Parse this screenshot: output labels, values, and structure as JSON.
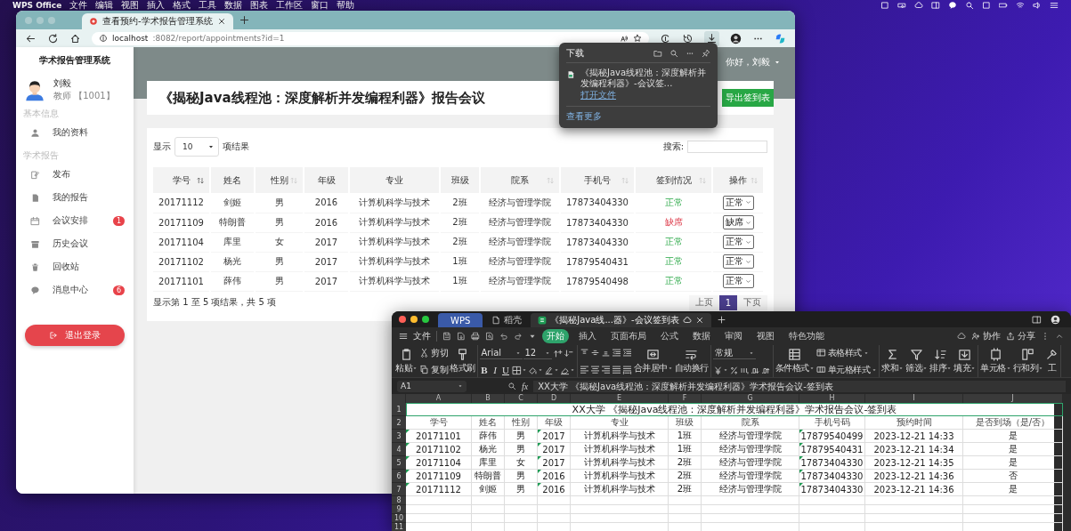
{
  "menubar": {
    "app": "WPS Office",
    "menus": [
      "文件",
      "编辑",
      "视图",
      "插入",
      "格式",
      "工具",
      "数据",
      "图表",
      "工作区",
      "窗口",
      "帮助"
    ]
  },
  "browser": {
    "tabs": [
      {
        "title": "查看预约-学术报告管理系统",
        "selected": true
      }
    ],
    "url": {
      "host": "localhost",
      "path": ":8082/report/appointments?id=1"
    },
    "sidebar": {
      "title": "学术报告管理系统",
      "user": {
        "name": "刘毅",
        "role": "教师 【1001】"
      },
      "sections": [
        {
          "heading": "基本信息",
          "items": [
            {
              "label": "我的资料"
            }
          ]
        },
        {
          "heading": "学术报告",
          "items": [
            {
              "label": "发布"
            },
            {
              "label": "我的报告"
            },
            {
              "label": "会议安排",
              "badge": "1"
            },
            {
              "label": "历史会议"
            },
            {
              "label": "回收站"
            },
            {
              "label": "消息中心",
              "badge": "6"
            }
          ]
        }
      ],
      "logout": "退出登录"
    },
    "greeting": "你好，刘毅",
    "page_title": "《揭秘Java线程池：深度解析并发编程利器》报告会议",
    "export_button": "导出签到表",
    "table_controls": {
      "show_label": "显示",
      "page_size": "10",
      "show_suffix": "项结果",
      "search_label": "搜索:"
    },
    "table": {
      "columns": [
        {
          "label": "学号",
          "sortable": true,
          "sorted": true
        },
        {
          "label": "姓名",
          "sortable": false,
          "sorted": false
        },
        {
          "label": "性别",
          "sortable": true,
          "sorted": false
        },
        {
          "label": "年级",
          "sortable": false,
          "sorted": false
        },
        {
          "label": "专业",
          "sortable": false,
          "sorted": false
        },
        {
          "label": "班级",
          "sortable": false,
          "sorted": false
        },
        {
          "label": "院系",
          "sortable": true,
          "sorted": false
        },
        {
          "label": "手机号",
          "sortable": true,
          "sorted": false
        },
        {
          "label": "签到情况",
          "sortable": true,
          "sorted": false
        },
        {
          "label": "操作",
          "sortable": true,
          "sorted": false
        }
      ],
      "rows": [
        {
          "cells": [
            "20171112",
            "剑姬",
            "男",
            "2016",
            "计算机科学与技术",
            "2班",
            "经济与管理学院",
            "17873404330"
          ],
          "status": {
            "text": "正常",
            "kind": "normal"
          },
          "action": "正常"
        },
        {
          "cells": [
            "20171109",
            "特朗普",
            "男",
            "2016",
            "计算机科学与技术",
            "2班",
            "经济与管理学院",
            "17873404330"
          ],
          "status": {
            "text": "缺席",
            "kind": "absent"
          },
          "action": "缺席"
        },
        {
          "cells": [
            "20171104",
            "库里",
            "女",
            "2017",
            "计算机科学与技术",
            "2班",
            "经济与管理学院",
            "17873404330"
          ],
          "status": {
            "text": "正常",
            "kind": "normal"
          },
          "action": "正常"
        },
        {
          "cells": [
            "20171102",
            "杨光",
            "男",
            "2017",
            "计算机科学与技术",
            "1班",
            "经济与管理学院",
            "17879540431"
          ],
          "status": {
            "text": "正常",
            "kind": "normal"
          },
          "action": "正常"
        },
        {
          "cells": [
            "20171101",
            "薛伟",
            "男",
            "2017",
            "计算机科学与技术",
            "1班",
            "经济与管理学院",
            "17879540498"
          ],
          "status": {
            "text": "正常",
            "kind": "normal"
          },
          "action": "正常"
        }
      ]
    },
    "table_info": "显示第 1 至 5 项结果，共 5 项",
    "pagination": [
      {
        "label": "上页",
        "selected": false
      },
      {
        "label": "1",
        "selected": true
      },
      {
        "label": "下页",
        "selected": false
      }
    ],
    "downloads": {
      "title": "下载",
      "file": "《揭秘Java线程池：深度解析并发编程利器》-会议签…",
      "open_link": "打开文件",
      "more": "查看更多"
    }
  },
  "wps": {
    "tabs": [
      {
        "label": "WPS",
        "kind": "home",
        "selected": false
      },
      {
        "label": "稻壳",
        "kind": "docer",
        "selected": false
      },
      {
        "label": "《揭秘Java线...器》-会议签到表",
        "kind": "sheet",
        "selected": true
      }
    ],
    "file_menu": "文件",
    "ribbon_tabs": [
      {
        "label": "开始",
        "selected": true
      },
      {
        "label": "插入",
        "selected": false
      },
      {
        "label": "页面布局",
        "selected": false
      },
      {
        "label": "公式",
        "selected": false
      },
      {
        "label": "数据",
        "selected": false
      },
      {
        "label": "审阅",
        "selected": false
      },
      {
        "label": "视图",
        "selected": false
      },
      {
        "label": "特色功能",
        "selected": false
      }
    ],
    "collab": "协作",
    "share": "分享",
    "ribbon": [
      [
        [
          [
            {
              "kind": "big-menu",
              "label": "粘贴"
            }
          ]
        ],
        [
          [
            {
              "kind": "small",
              "label": "剪切"
            }
          ],
          [
            {
              "kind": "small",
              "label": "复制"
            }
          ]
        ],
        [
          [
            {
              "kind": "big",
              "label": "格式刷"
            }
          ]
        ]
      ],
      [
        [
          [
            {
              "kind": "select-wide",
              "value": "Arial"
            },
            {
              "kind": "select",
              "value": "12"
            },
            {
              "kind": "icon"
            },
            {
              "kind": "icon"
            }
          ],
          [
            {
              "kind": "glyph-bold",
              "value": "B"
            },
            {
              "kind": "glyph-italic",
              "value": "I"
            },
            {
              "kind": "glyph-underline",
              "value": "U"
            },
            {
              "kind": "icon-menu"
            },
            {
              "kind": "icon-menu"
            },
            {
              "kind": "icon-menu"
            },
            {
              "kind": "icon-menu"
            }
          ]
        ]
      ],
      [
        [
          [
            {
              "kind": "icon"
            },
            {
              "kind": "icon"
            },
            {
              "kind": "icon"
            },
            {
              "kind": "icon"
            },
            {
              "kind": "icon"
            }
          ],
          [
            {
              "kind": "icon"
            },
            {
              "kind": "icon"
            },
            {
              "kind": "icon"
            },
            {
              "kind": "icon"
            },
            {
              "kind": "icon"
            }
          ]
        ],
        [
          [
            {
              "kind": "big-menu",
              "label": "合并居中"
            }
          ]
        ],
        [
          [
            {
              "kind": "big",
              "label": "自动换行"
            }
          ]
        ]
      ],
      [
        [
          [
            {
              "kind": "select-wide",
              "value": "常规"
            }
          ],
          [
            {
              "kind": "icon-menu"
            },
            {
              "kind": "icon"
            },
            {
              "kind": "icon"
            },
            {
              "kind": "icon"
            },
            {
              "kind": "icon"
            }
          ]
        ]
      ],
      [
        [
          [
            {
              "kind": "big-menu",
              "label": "条件格式"
            }
          ]
        ],
        [
          [
            {
              "kind": "small-menu",
              "label": "表格样式"
            }
          ],
          [
            {
              "kind": "small-menu",
              "label": "单元格样式"
            }
          ]
        ]
      ],
      [
        [
          [
            {
              "kind": "big-menu",
              "label": "求和"
            }
          ]
        ],
        [
          [
            {
              "kind": "big-menu",
              "label": "筛选"
            }
          ]
        ],
        [
          [
            {
              "kind": "big-menu",
              "label": "排序"
            }
          ]
        ],
        [
          [
            {
              "kind": "big-menu",
              "label": "填充"
            }
          ]
        ]
      ],
      [
        [
          [
            {
              "kind": "big-menu",
              "label": "单元格"
            }
          ]
        ],
        [
          [
            {
              "kind": "big-menu",
              "label": "行和列"
            }
          ]
        ],
        [
          [
            {
              "kind": "big",
              "label": "工"
            }
          ]
        ]
      ]
    ],
    "name_box": "A1",
    "fx": "fx",
    "formula": "XX大学 《揭秘Java线程池：深度解析并发编程利器》学术报告会议-签到表",
    "sheet": {
      "columns": [
        {
          "letter": "A",
          "flagged": true
        },
        {
          "letter": "B",
          "flagged": false
        },
        {
          "letter": "C",
          "flagged": false
        },
        {
          "letter": "D",
          "flagged": true
        },
        {
          "letter": "E",
          "flagged": false
        },
        {
          "letter": "F",
          "flagged": false
        },
        {
          "letter": "G",
          "flagged": false
        },
        {
          "letter": "H",
          "flagged": true
        },
        {
          "letter": "I",
          "flagged": false
        },
        {
          "letter": "J",
          "flagged": false
        }
      ],
      "rows": [
        {
          "number": "1",
          "kind": "title",
          "cells": [
            "XX大学 《揭秘Java线程池：深度解析并发编程利器》学术报告会议-签到表"
          ]
        },
        {
          "number": "2",
          "kind": "header",
          "cells": [
            "学号",
            "姓名",
            "性别",
            "年级",
            "专业",
            "班级",
            "院系",
            "手机号码",
            "预约时间",
            "是否到场（是/否）"
          ]
        },
        {
          "number": "3",
          "kind": "data",
          "cells": [
            "20171101",
            "薛伟",
            "男",
            "2017",
            "计算机科学与技术",
            "1班",
            "经济与管理学院",
            "17879540499",
            "2023-12-21 14:33",
            "是"
          ]
        },
        {
          "number": "4",
          "kind": "data",
          "cells": [
            "20171102",
            "杨光",
            "男",
            "2017",
            "计算机科学与技术",
            "1班",
            "经济与管理学院",
            "17879540431",
            "2023-12-21 14:34",
            "是"
          ]
        },
        {
          "number": "5",
          "kind": "data",
          "cells": [
            "20171104",
            "库里",
            "女",
            "2017",
            "计算机科学与技术",
            "2班",
            "经济与管理学院",
            "17873404330",
            "2023-12-21 14:35",
            "是"
          ]
        },
        {
          "number": "6",
          "kind": "data",
          "cells": [
            "20171109",
            "特朗普",
            "男",
            "2016",
            "计算机科学与技术",
            "2班",
            "经济与管理学院",
            "17873404330",
            "2023-12-21 14:36",
            "否"
          ]
        },
        {
          "number": "7",
          "kind": "data",
          "cells": [
            "20171112",
            "剑姬",
            "男",
            "2016",
            "计算机科学与技术",
            "2班",
            "经济与管理学院",
            "17873404330",
            "2023-12-21 14:36",
            "是"
          ]
        },
        {
          "number": "8",
          "kind": "empty"
        },
        {
          "number": "9",
          "kind": "empty"
        },
        {
          "number": "10",
          "kind": "empty"
        },
        {
          "number": "11",
          "kind": "empty"
        }
      ]
    }
  }
}
